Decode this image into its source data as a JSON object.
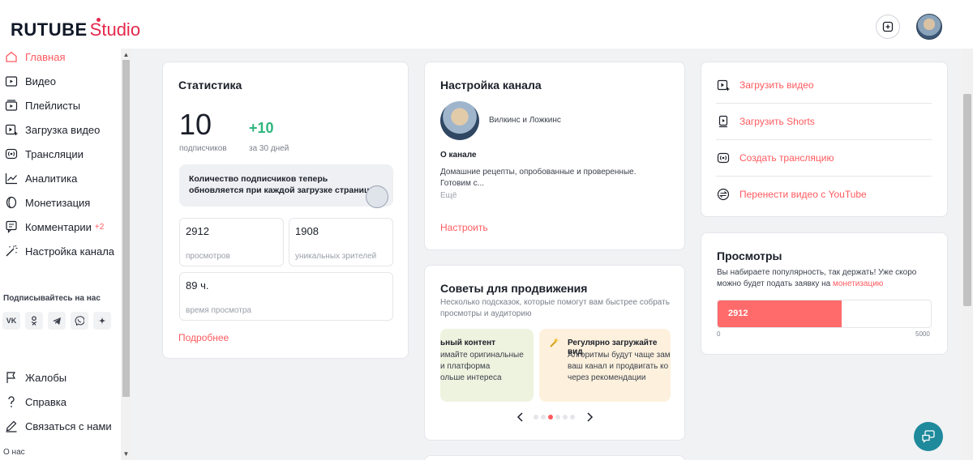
{
  "header": {
    "logo_main": "RUTUBE",
    "logo_sub": "Studio"
  },
  "sidebar": {
    "items": [
      {
        "label": "Главная",
        "icon": "home-icon",
        "active": true
      },
      {
        "label": "Видео",
        "icon": "video-icon"
      },
      {
        "label": "Плейлисты",
        "icon": "playlist-icon"
      },
      {
        "label": "Загрузка видео",
        "icon": "upload-icon"
      },
      {
        "label": "Трансляции",
        "icon": "broadcast-icon"
      },
      {
        "label": "Аналитика",
        "icon": "analytics-icon"
      },
      {
        "label": "Монетизация",
        "icon": "monetization-icon"
      },
      {
        "label": "Комментарии",
        "icon": "comments-icon",
        "badge": "+2"
      },
      {
        "label": "Настройка канала",
        "icon": "magic-wand-icon"
      }
    ],
    "follow_title": "Подписывайтесь на нас",
    "socials": [
      "vk-icon",
      "odnoklassniki-icon",
      "telegram-icon",
      "viber-icon",
      "dzen-icon"
    ],
    "bottom_items": [
      {
        "label": "Жалобы",
        "icon": "flag-icon"
      },
      {
        "label": "Справка",
        "icon": "help-icon"
      },
      {
        "label": "Связаться с нами",
        "icon": "pen-icon"
      }
    ],
    "about": "О нас"
  },
  "stats": {
    "title": "Статистика",
    "subscribers": "10",
    "subscribers_label": "подписчиков",
    "delta": "+10",
    "delta_label": "за 30 дней",
    "notice": "Количество подписчиков теперь обновляется при каждой загрузке страницы",
    "views": "2912",
    "views_label": "просмотров",
    "unique": "1908",
    "unique_label": "уникальных зрителей",
    "watch_time": "89 ч.",
    "watch_time_label": "время просмотра",
    "more": "Подробнее"
  },
  "channel": {
    "title": "Настройка канала",
    "name": "Вилкинс и Ложкинс",
    "about_title": "О канале",
    "description_1": "Домашние рецепты, опробованные и проверенные.",
    "description_2": "Готовим с...",
    "more": "Ещё",
    "configure": "Настроить"
  },
  "tips": {
    "title": "Советы для продвижения",
    "subtitle_1": "Несколько подсказок, которые помогут вам быстрее собрать",
    "subtitle_2": "просмотры и аудиторию",
    "card1": {
      "title": "ьный контент",
      "lines": [
        "имайте оригинальные",
        "и платформа",
        "ольше интереса"
      ],
      "color": "#eef3df"
    },
    "card2": {
      "title": "Регулярно загружайте вид",
      "lines": [
        "Алгоритмы будут чаще зам",
        "ваш канал и продвигать ко",
        "через рекомендации"
      ],
      "color": "#fdf1dd"
    },
    "dots_total": 6,
    "dots_active": 3
  },
  "actions": [
    {
      "label": "Загрузить видео",
      "icon": "upload-video-icon"
    },
    {
      "label": "Загрузить Shorts",
      "icon": "shorts-icon"
    },
    {
      "label": "Создать трансляцию",
      "icon": "broadcast-icon"
    },
    {
      "label": "Перенести видео с YouTube",
      "icon": "transfer-icon"
    }
  ],
  "views_card": {
    "title": "Просмотры",
    "text_1": "Вы набираете популярность, так держать! Уже скоро",
    "text_2": "можно будет подать заявку на",
    "link": "монетизацию",
    "value": "2912",
    "progress": 0.5824,
    "min": "0",
    "max": "5000"
  },
  "colors": {
    "accent": "#ff5a5f",
    "positive": "#2eb67d",
    "brand_red": "#e4284c",
    "fab": "#1e8a9b"
  }
}
